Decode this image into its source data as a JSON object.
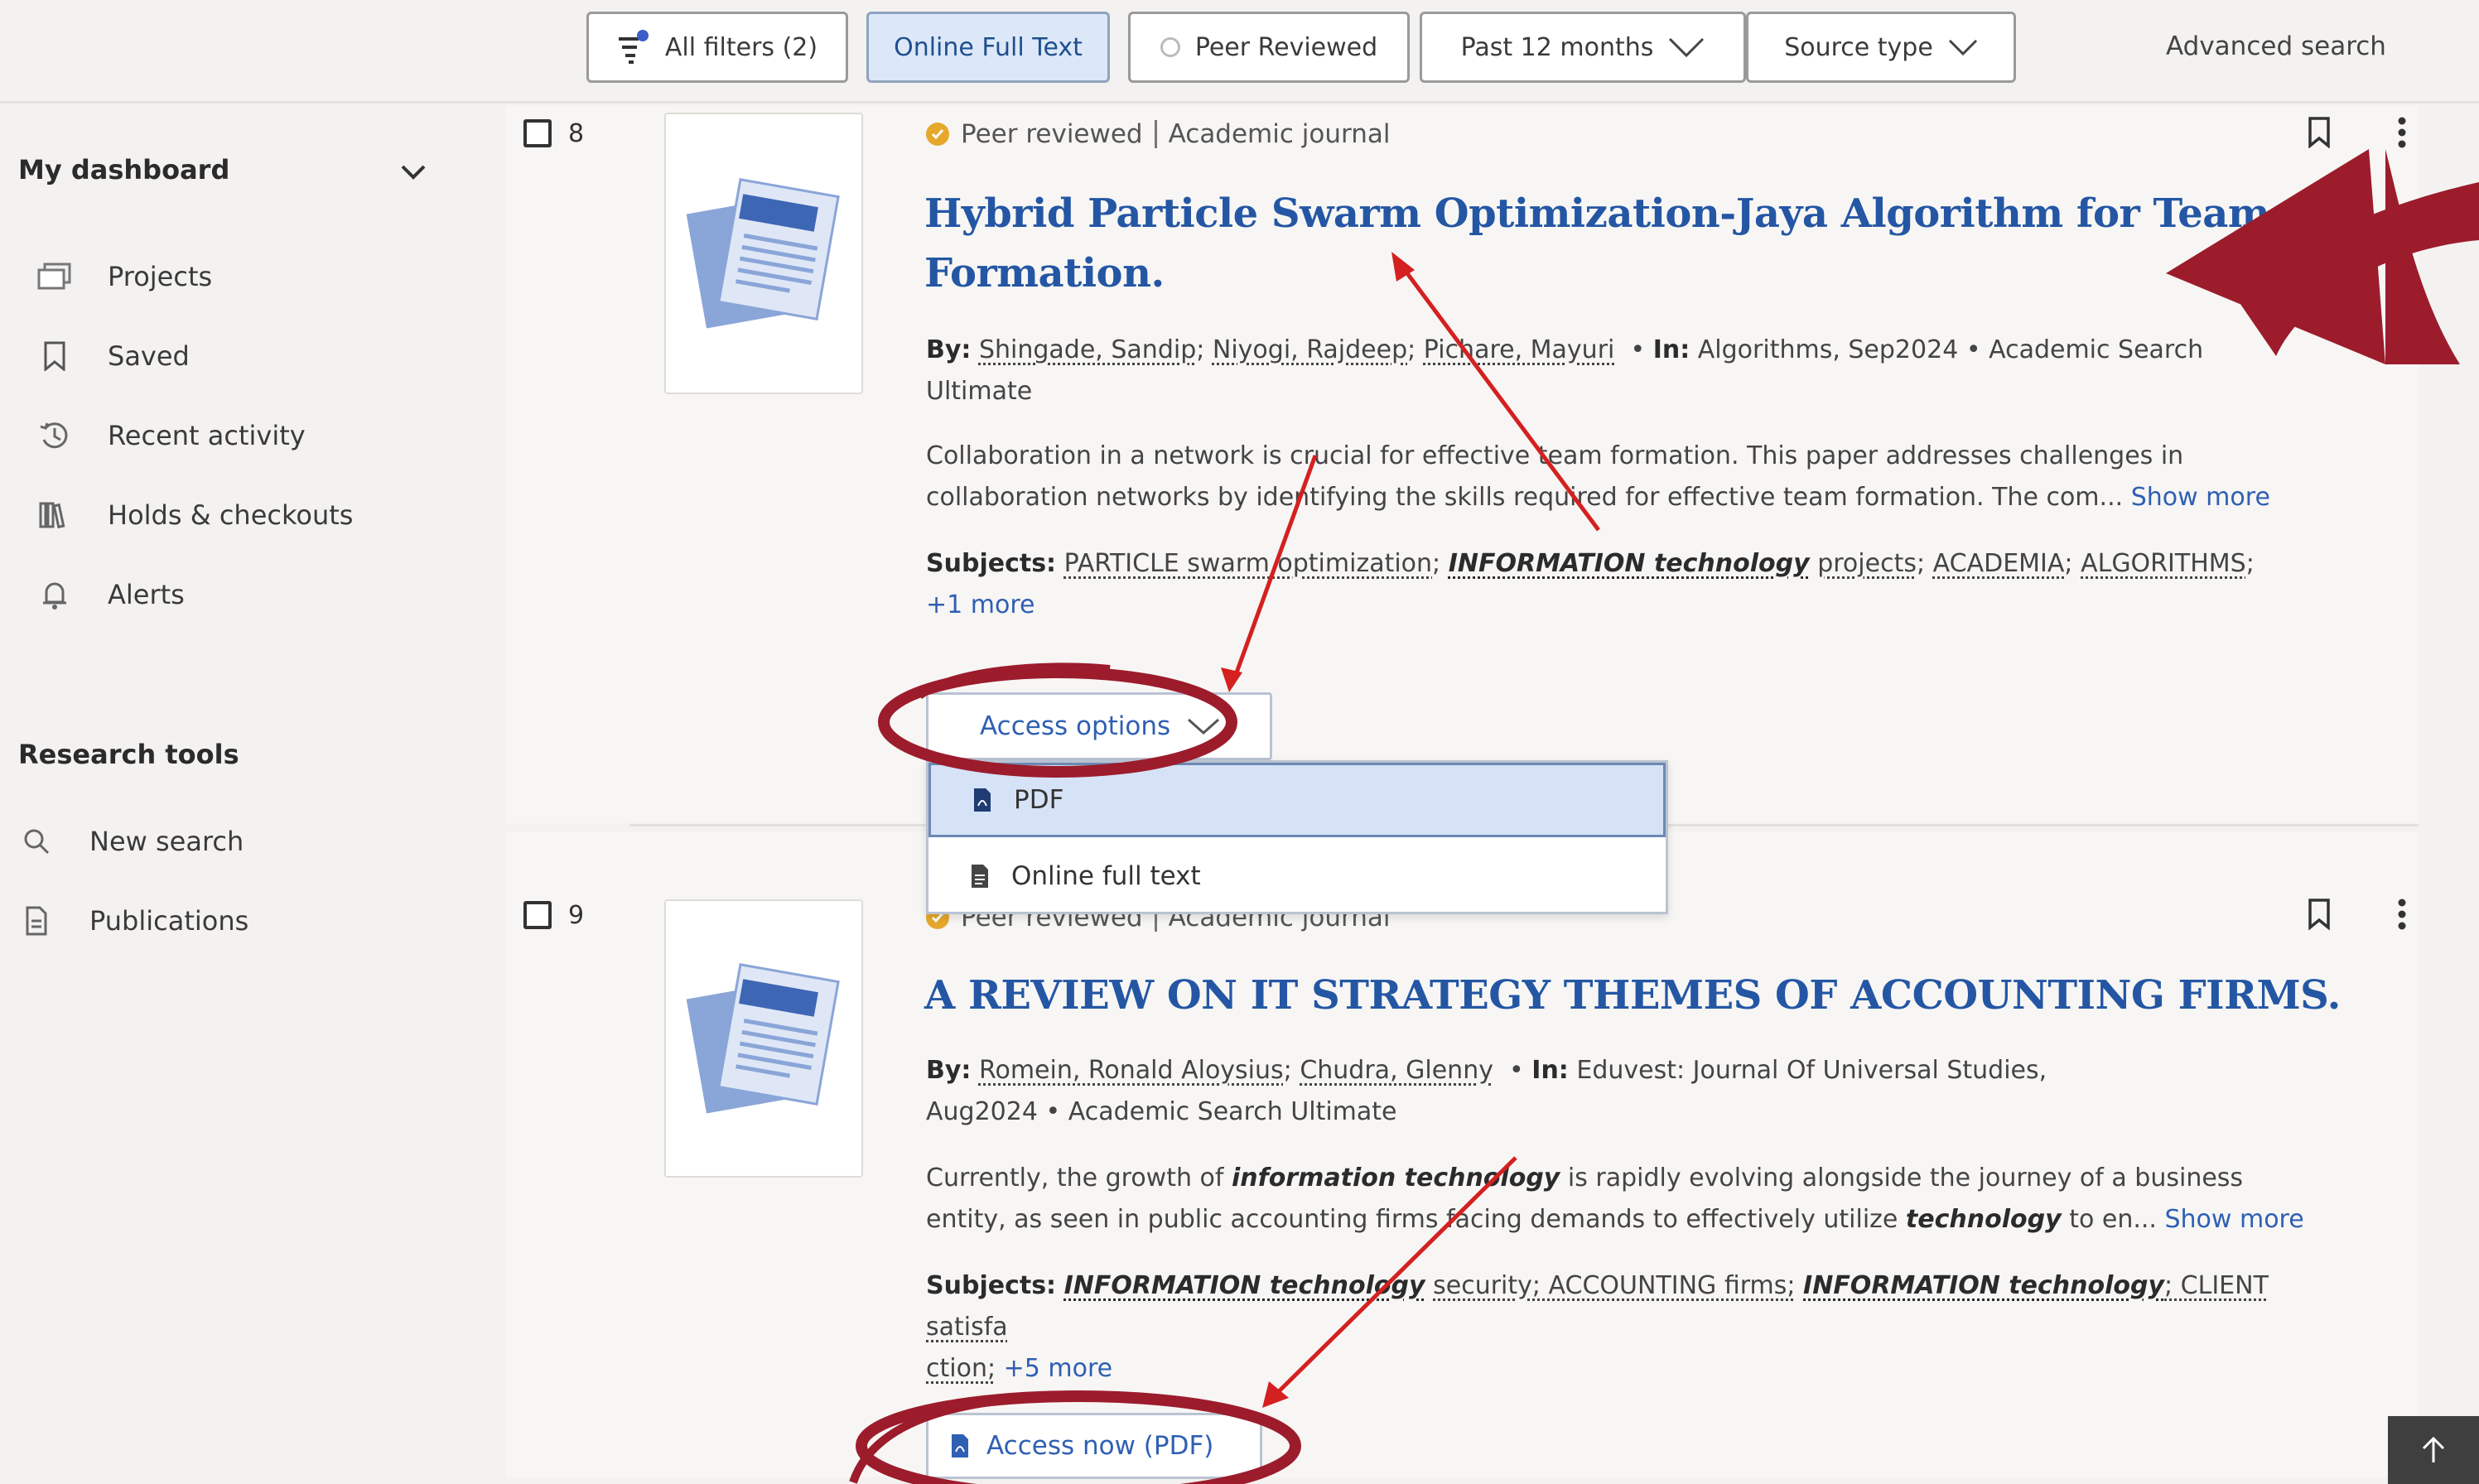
{
  "filters": {
    "all_filters": "All filters (2)",
    "online_full_text": "Online Full Text",
    "peer_reviewed": "Peer Reviewed",
    "past_12_months": "Past 12 months",
    "source_type": "Source type",
    "advanced_search": "Advanced search"
  },
  "sidebar": {
    "dashboard_heading": "My dashboard",
    "dashboard_items": [
      {
        "label": "Projects",
        "icon": "projects-icon"
      },
      {
        "label": "Saved",
        "icon": "bookmark-icon"
      },
      {
        "label": "Recent activity",
        "icon": "history-icon"
      },
      {
        "label": "Holds & checkouts",
        "icon": "library-icon"
      },
      {
        "label": "Alerts",
        "icon": "bell-icon"
      }
    ],
    "tools_heading": "Research tools",
    "tools_items": [
      {
        "label": "New search",
        "icon": "search-icon"
      },
      {
        "label": "Publications",
        "icon": "document-icon"
      }
    ]
  },
  "results": [
    {
      "number": "8",
      "peer": "Peer reviewed",
      "type": "Academic journal",
      "title_line1": "Hybrid Particle Swarm Optimization-Jaya Algorithm for Team",
      "title_line2": "Formation.",
      "by_label": "By:",
      "authors": [
        "Shingade, Sandip",
        "Niyogi, Rajdeep",
        "Pichare, Mayuri"
      ],
      "in_label": "In:",
      "source": "Algorithms, Sep2024",
      "database_part1": "Academic Search",
      "database_part2": "Ultimate",
      "abstract_line1": "Collaboration in a network is crucial for effective team formation. This paper addresses challenges in",
      "abstract_line2": "collaboration networks by identifying the skills required for effective team formation. The com...",
      "show_more": "Show more",
      "subjects_label": "Subjects:",
      "subjects": [
        "PARTICLE swarm optimization",
        "INFORMATION technology",
        "projects",
        "ACADEMIA",
        "ALGORITHMS"
      ],
      "subjects_more": "+1 more",
      "access_label": "Access options",
      "dropdown": [
        "PDF",
        "Online full text"
      ]
    },
    {
      "number": "9",
      "peer": "Peer reviewed",
      "type": "Academic journal",
      "title": "A REVIEW ON IT STRATEGY THEMES OF ACCOUNTING FIRMS.",
      "by_label": "By:",
      "authors": [
        "Romein, Ronald Aloysius",
        "Chudra, Glenny"
      ],
      "in_label": "In:",
      "source_part1": "Eduvest: Journal Of Universal Studies,",
      "source_part2": "Aug2024",
      "database": "Academic Search Ultimate",
      "abstract_a": "Currently, the growth of",
      "abstract_b": "information technology",
      "abstract_c": "is rapidly evolving alongside the journey of a business",
      "abstract_d": "entity, as seen in public accounting firms facing demands to effectively utilize",
      "abstract_e": "technology",
      "abstract_f": "to en...",
      "show_more": "Show more",
      "subjects_label": "Subjects:",
      "subj_a": "INFORMATION technology",
      "subj_b": "security; ACCOUNTING firms;",
      "subj_c": "INFORMATION technology",
      "subj_d": "; CLIENT satisfa",
      "subj_e": "ction;",
      "subjects_more": "+5 more",
      "access_label": "Access now (PDF)"
    }
  ],
  "colors": {
    "title_blue": "#2456a4",
    "link_blue": "#2f5fb3",
    "peer_badge": "#e6a82b",
    "annotation_red": "#9c1c2c",
    "arrow_red": "#d42020"
  }
}
